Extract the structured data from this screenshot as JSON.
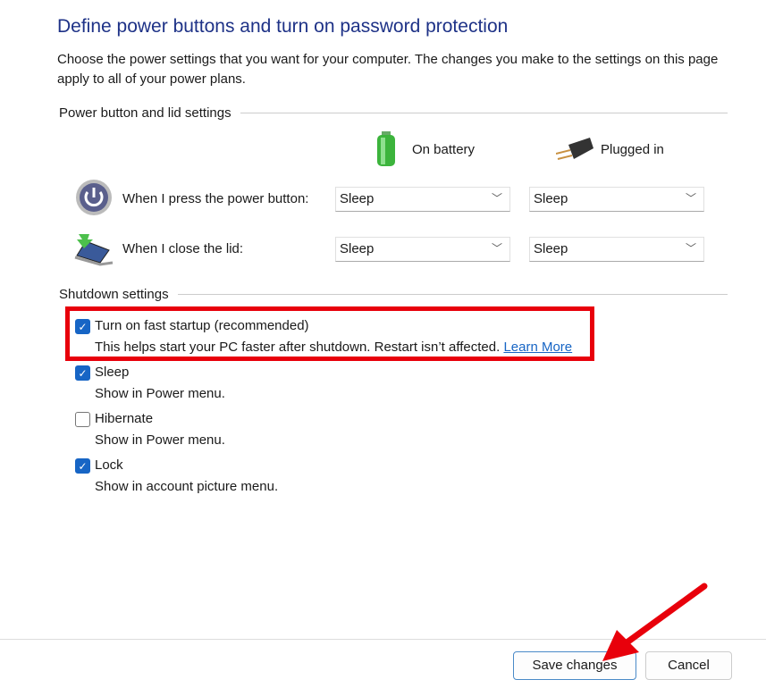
{
  "title": "Define power buttons and turn on password protection",
  "description": "Choose the power settings that you want for your computer. The changes you make to the settings on this page apply to all of your power plans.",
  "power_group": "Power button and lid settings",
  "columns": {
    "battery": "On battery",
    "plugged": "Plugged in"
  },
  "rows": [
    {
      "label": "When I press the power button:",
      "battery": "Sleep",
      "plugged": "Sleep",
      "icon": "power-icon"
    },
    {
      "label": "When I close the lid:",
      "battery": "Sleep",
      "plugged": "Sleep",
      "icon": "laptop-lid-icon"
    }
  ],
  "shutdown_group": "Shutdown settings",
  "options": [
    {
      "label": "Turn on fast startup (recommended)",
      "desc": "This helps start your PC faster after shutdown. Restart isn’t affected.",
      "link": "Learn More",
      "checked": true
    },
    {
      "label": "Sleep",
      "desc": "Show in Power menu.",
      "checked": true
    },
    {
      "label": "Hibernate",
      "desc": "Show in Power menu.",
      "checked": false
    },
    {
      "label": "Lock",
      "desc": "Show in account picture menu.",
      "checked": true
    }
  ],
  "buttons": {
    "save": "Save changes",
    "cancel": "Cancel"
  },
  "colors": {
    "highlight": "#e8000b",
    "accent": "#1765c5",
    "title": "#1e3287"
  }
}
